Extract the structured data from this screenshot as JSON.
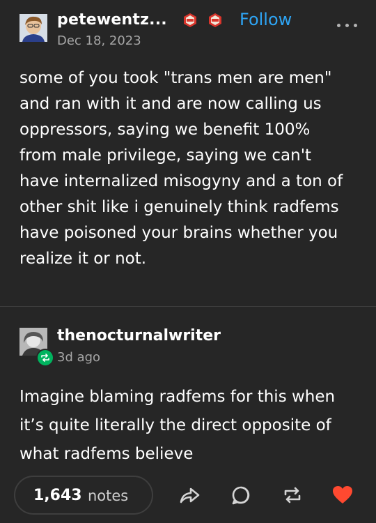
{
  "post": {
    "username": "petewentz...",
    "follow_label": "Follow",
    "date": "Dec 18, 2023",
    "badges": [
      "badge-icon",
      "badge-icon"
    ],
    "body_lines": [
      "some of you took \"trans men are men\"",
      "and ran with it and are now calling us",
      "oppressors, saying we benefit 100%",
      "from male privilege, saying we can't",
      "have internalized misogyny and a ton of",
      "other shit like i genuinely think radfems",
      "have poisoned your brains whether you",
      "realize it or not."
    ]
  },
  "reblog": {
    "username": "thenocturnalwriter",
    "time_ago": "3d ago",
    "body_lines": [
      "Imagine blaming radfems for this when",
      "it’s quite literally the direct opposite of",
      "what radfems believe"
    ]
  },
  "footer": {
    "notes_count": "1,643",
    "notes_label": "notes",
    "icons": [
      "share-icon",
      "reply-icon",
      "reblog-icon",
      "like-icon"
    ]
  },
  "colors": {
    "background": "#262626",
    "accent_blue": "#2ea5f5",
    "like_red": "#ff4930",
    "reblog_green": "#00b35e",
    "badge_red": "#d9352c"
  }
}
